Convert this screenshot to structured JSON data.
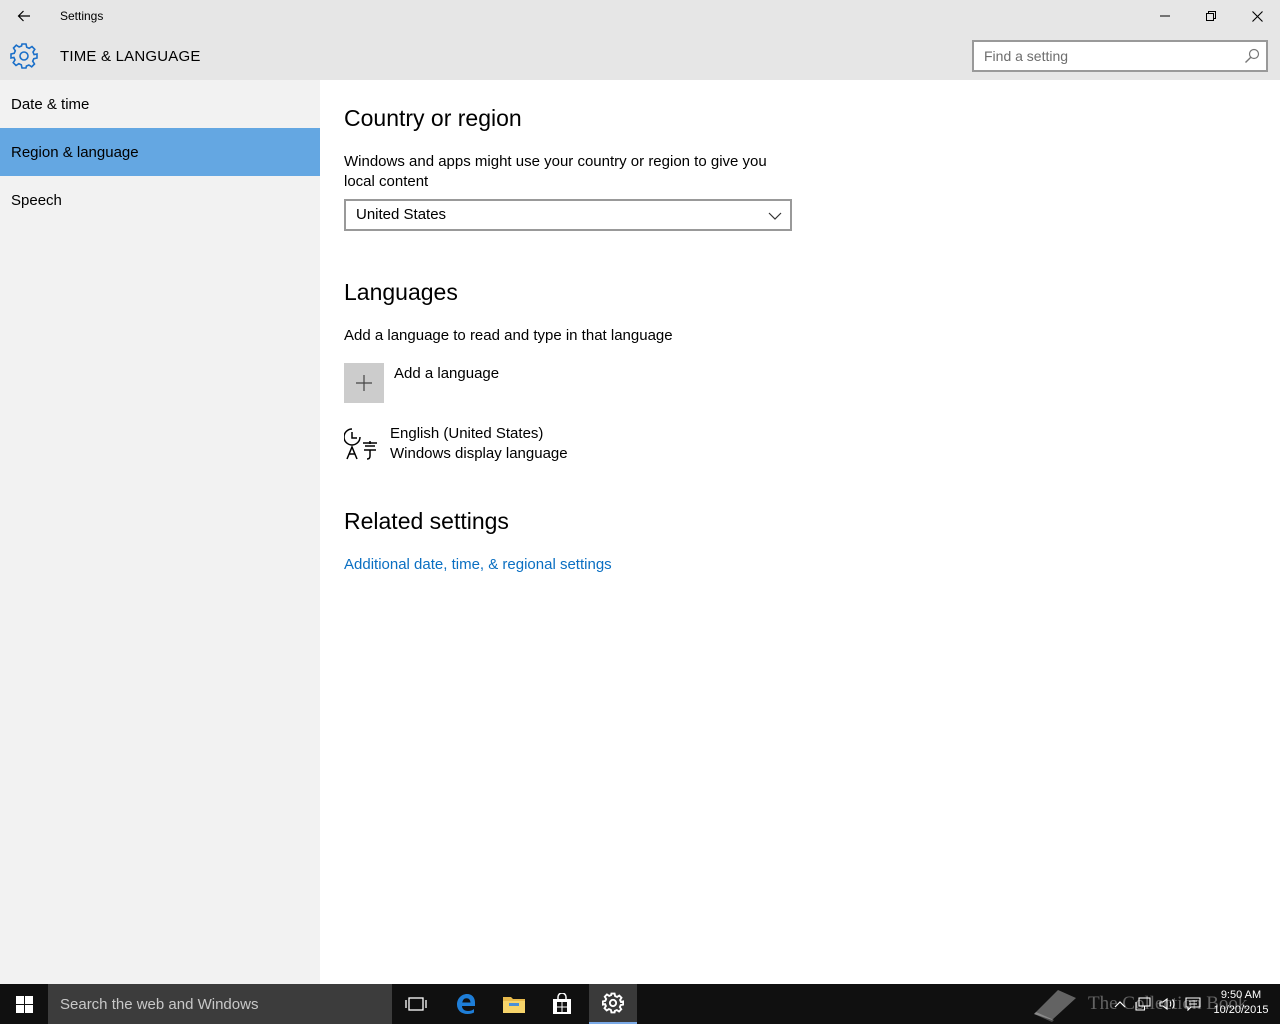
{
  "window": {
    "title": "Settings",
    "back_icon": "back-arrow-icon",
    "minimize_icon": "minimize-icon",
    "maximize_icon": "restore-icon",
    "close_icon": "close-icon"
  },
  "header": {
    "icon": "gear-icon",
    "title": "TIME & LANGUAGE",
    "search_placeholder": "Find a setting",
    "search_icon": "search-icon"
  },
  "sidebar": {
    "items": [
      {
        "label": "Date & time",
        "active": false
      },
      {
        "label": "Region & language",
        "active": true
      },
      {
        "label": "Speech",
        "active": false
      }
    ],
    "active_color": "#64a7e2"
  },
  "main": {
    "country": {
      "heading": "Country or region",
      "description_line1": "Windows and apps might use your country or region to give you",
      "description_line2": "local content",
      "selected": "United States"
    },
    "languages": {
      "heading": "Languages",
      "description": "Add a language to read and type in that language",
      "add_label": "Add a language",
      "items": [
        {
          "name": "English (United States)",
          "subtitle": "Windows display language",
          "icon": "language-icon"
        }
      ]
    },
    "related": {
      "heading": "Related settings",
      "link": "Additional date, time, & regional settings",
      "link_color": "#0a6fc2"
    }
  },
  "taskbar": {
    "search_placeholder": "Search the web and Windows",
    "icons": [
      "windows-start-icon",
      "task-view-icon",
      "edge-icon",
      "file-explorer-icon",
      "store-icon",
      "settings-icon"
    ],
    "watermark": "The Collection Book",
    "time": "9:50 AM",
    "date": "10/20/2015"
  }
}
